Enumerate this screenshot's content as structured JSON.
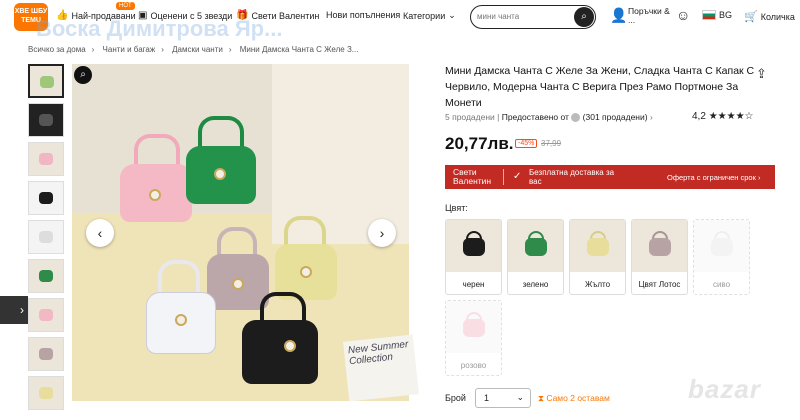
{
  "header": {
    "logo_lines": [
      "ХВЕ ШБУ",
      "TEMU"
    ],
    "hot_badge": "HOT",
    "nav": [
      {
        "label": "Най-продавани",
        "icon": "thumbs-up-icon"
      },
      {
        "label": "Оценени с 5 звезди",
        "icon": "star-box-icon"
      },
      {
        "label": "Свети Валентин",
        "icon": "gift-icon"
      },
      {
        "label": "Нови попълнения",
        "icon": ""
      },
      {
        "label": "Категории",
        "icon": "chevron-down-icon"
      }
    ],
    "search_placeholder": "мини чанта",
    "orders_label": "Поръчки & ...",
    "lang": "BG",
    "cart_label": "Количка",
    "watermark": "Воска Димитрова Яр..."
  },
  "breadcrumb": [
    "Всичко за дома",
    "Чанти и багаж",
    "Дамски чанти",
    "Мини Дамска Чанта С Желе З..."
  ],
  "product": {
    "title": "Мини Дамска Чанта С Желе За Жени, Сладка Чанта С Капак С Червило, Модерна Чанта С Верига През Рамо Портмоне За Монети",
    "sold": "5 продадени",
    "provided_by": "Предоставено от",
    "seller_sold": "(301 продадени)",
    "rating": "4,2",
    "price": "20,77лв.",
    "discount": "-45%",
    "old_price": "37,99",
    "book_text": "New Summer Collection"
  },
  "banner": {
    "left": "Свети Валентин",
    "middle": "Безплатна доставка за вас",
    "right": "Оферта с ограничен срок"
  },
  "color_label": "Цвят:",
  "colors": [
    {
      "label": "черен",
      "swatch": "#1c1c1c"
    },
    {
      "label": "зелено",
      "swatch": "#2e8b4a"
    },
    {
      "label": "Жълто",
      "swatch": "#e8dd9a"
    },
    {
      "label": "Цвят Лотос",
      "swatch": "#b7a3a3"
    },
    {
      "label": "сиво",
      "swatch": "#e6e6e6"
    },
    {
      "label": "розово",
      "swatch": "#f2b8c4"
    }
  ],
  "quantity": {
    "label": "Брой",
    "value": "1",
    "stock": "Само 2 оставам"
  },
  "watermark_brand": "bazar"
}
